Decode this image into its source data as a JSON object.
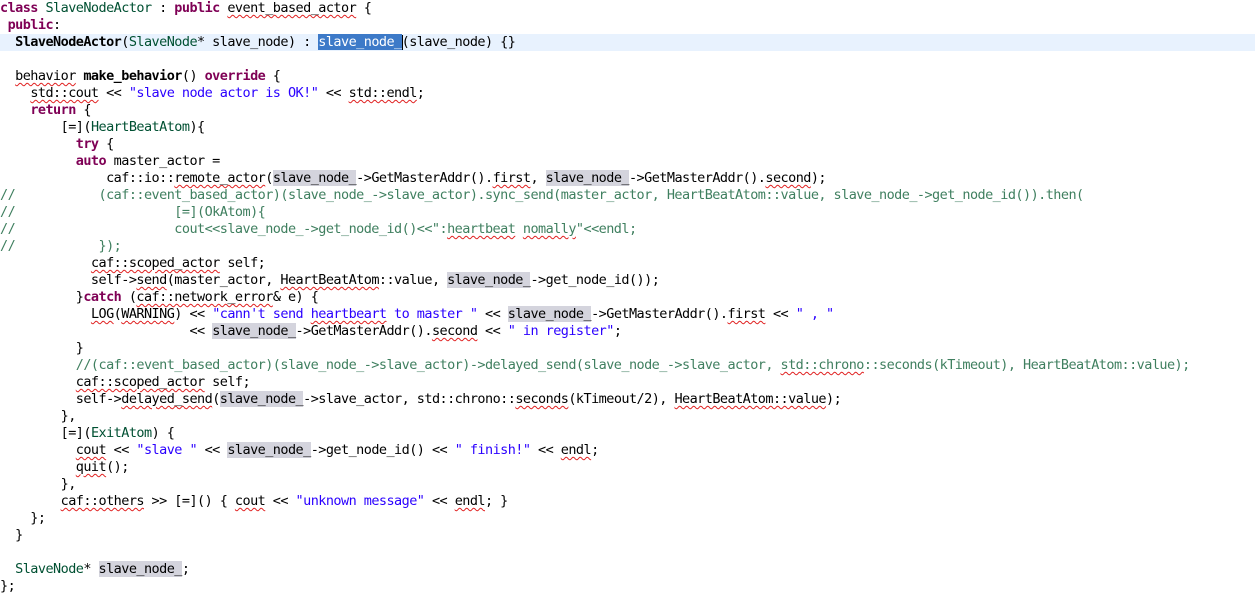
{
  "editor": {
    "lines": [
      [
        {
          "t": "class",
          "c": "kw"
        },
        {
          "t": " "
        },
        {
          "t": "SlaveNodeActor",
          "c": "type"
        },
        {
          "t": " : "
        },
        {
          "t": "public",
          "c": "kw"
        },
        {
          "t": " "
        },
        {
          "t": "event_based_actor",
          "c": "err"
        },
        {
          "t": " {"
        }
      ],
      [
        {
          "t": " "
        },
        {
          "t": "public",
          "c": "kw"
        },
        {
          "t": ":"
        }
      ],
      [
        {
          "t": "  "
        },
        {
          "t": "SlaveNodeActor",
          "c": "fn"
        },
        {
          "t": "("
        },
        {
          "t": "SlaveNode",
          "c": "type"
        },
        {
          "t": "* slave_node) : "
        },
        {
          "t": "slave_node_",
          "c": "sel",
          "caret": true
        },
        {
          "t": "(slave_node) {}"
        }
      ],
      [],
      [
        {
          "t": "  "
        },
        {
          "t": "behavior",
          "c": "err"
        },
        {
          "t": " "
        },
        {
          "t": "make_behavior",
          "c": "fn"
        },
        {
          "t": "() "
        },
        {
          "t": "override",
          "c": "kw"
        },
        {
          "t": " {"
        }
      ],
      [
        {
          "t": "    "
        },
        {
          "t": "std::cout",
          "c": "err"
        },
        {
          "t": " << "
        },
        {
          "t": "\"slave node actor is OK!\"",
          "c": "str"
        },
        {
          "t": " << "
        },
        {
          "t": "std::endl",
          "c": "err"
        },
        {
          "t": ";"
        }
      ],
      [
        {
          "t": "    "
        },
        {
          "t": "return",
          "c": "kw"
        },
        {
          "t": " {"
        }
      ],
      [
        {
          "t": "        [=]("
        },
        {
          "t": "HeartBeatAtom",
          "c": "type"
        },
        {
          "t": "){"
        }
      ],
      [
        {
          "t": "          "
        },
        {
          "t": "try",
          "c": "kw"
        },
        {
          "t": " {"
        }
      ],
      [
        {
          "t": "          "
        },
        {
          "t": "auto",
          "c": "kw"
        },
        {
          "t": " master_actor ="
        }
      ],
      [
        {
          "t": "              caf::io::"
        },
        {
          "t": "remote_actor",
          "c": "err"
        },
        {
          "t": "("
        },
        {
          "t": "slave_node_",
          "c": "occ"
        },
        {
          "t": "->GetMasterAddr()."
        },
        {
          "t": "first",
          "c": "err"
        },
        {
          "t": ", "
        },
        {
          "t": "slave_node_",
          "c": "occ"
        },
        {
          "t": "->GetMasterAddr()."
        },
        {
          "t": "second",
          "c": "err"
        },
        {
          "t": ");"
        }
      ],
      [
        {
          "t": "//           (caf::event_based_actor)(slave_node_->slave_actor).sync_send(master_actor, HeartBeatAtom::value, slave_node_->get_node_id()).then(",
          "c": "com"
        }
      ],
      [
        {
          "t": "//                     [=](OkAtom){",
          "c": "com"
        }
      ],
      [
        {
          "t": "//                     cout<<slave_node_->get_node_id()<<\":",
          "c": "com"
        },
        {
          "t": "heartbeat",
          "c": "com err"
        },
        {
          "t": " ",
          "c": "com"
        },
        {
          "t": "nomally",
          "c": "com err"
        },
        {
          "t": "\"<<endl;",
          "c": "com"
        }
      ],
      [
        {
          "t": "//           });",
          "c": "com"
        }
      ],
      [
        {
          "t": "            "
        },
        {
          "t": "caf::scoped_actor",
          "c": "err"
        },
        {
          "t": " self;"
        }
      ],
      [
        {
          "t": "            self->"
        },
        {
          "t": "send",
          "c": "err"
        },
        {
          "t": "(master_actor, "
        },
        {
          "t": "HeartBeatAtom",
          "c": "err"
        },
        {
          "t": "::value, "
        },
        {
          "t": "slave_node_",
          "c": "occ"
        },
        {
          "t": "->get_node_id());"
        }
      ],
      [
        {
          "t": "          }"
        },
        {
          "t": "catch",
          "c": "kw"
        },
        {
          "t": " ("
        },
        {
          "t": "caf::network_error",
          "c": "err"
        },
        {
          "t": "& e) {"
        }
      ],
      [
        {
          "t": "            "
        },
        {
          "t": "LOG",
          "c": "err"
        },
        {
          "t": "("
        },
        {
          "t": "WARNING",
          "c": "err"
        },
        {
          "t": ") << "
        },
        {
          "t": "\"cann't send ",
          "c": "str"
        },
        {
          "t": "heartbeart",
          "c": "str err"
        },
        {
          "t": " to master \"",
          "c": "str"
        },
        {
          "t": " << "
        },
        {
          "t": "slave_node_",
          "c": "occ"
        },
        {
          "t": "->GetMasterAddr()."
        },
        {
          "t": "first",
          "c": "err"
        },
        {
          "t": " << "
        },
        {
          "t": "\" , \"",
          "c": "str"
        }
      ],
      [
        {
          "t": "                         << "
        },
        {
          "t": "slave_node_",
          "c": "occ"
        },
        {
          "t": "->GetMasterAddr()."
        },
        {
          "t": "second",
          "c": "err"
        },
        {
          "t": " << "
        },
        {
          "t": "\" in register\"",
          "c": "str"
        },
        {
          "t": ";"
        }
      ],
      [
        {
          "t": "          }"
        }
      ],
      [
        {
          "t": "          //(caf::event_based_actor)(slave_node_->slave_actor)->delayed_send(slave_node_->slave_actor, ",
          "c": "com"
        },
        {
          "t": "std::chrono",
          "c": "com err"
        },
        {
          "t": "::seconds(kTimeout), HeartBeatAtom::value);",
          "c": "com"
        }
      ],
      [
        {
          "t": "          "
        },
        {
          "t": "caf::scoped_actor",
          "c": "err"
        },
        {
          "t": " self;"
        }
      ],
      [
        {
          "t": "          self->"
        },
        {
          "t": "delayed_send",
          "c": "err"
        },
        {
          "t": "("
        },
        {
          "t": "slave_node_",
          "c": "occ"
        },
        {
          "t": "->slave_actor, std::chrono::"
        },
        {
          "t": "seconds",
          "c": "err"
        },
        {
          "t": "(kTimeout/2), "
        },
        {
          "t": "HeartBeatAtom::value",
          "c": "err"
        },
        {
          "t": ");"
        }
      ],
      [
        {
          "t": "        },"
        }
      ],
      [
        {
          "t": "        [=]("
        },
        {
          "t": "ExitAtom",
          "c": "type"
        },
        {
          "t": ") {"
        }
      ],
      [
        {
          "t": "          "
        },
        {
          "t": "cout",
          "c": "err"
        },
        {
          "t": " << "
        },
        {
          "t": "\"slave \"",
          "c": "str"
        },
        {
          "t": " << "
        },
        {
          "t": "slave_node_",
          "c": "occ"
        },
        {
          "t": "->get_node_id() << "
        },
        {
          "t": "\" finish!\"",
          "c": "str"
        },
        {
          "t": " << "
        },
        {
          "t": "endl",
          "c": "err"
        },
        {
          "t": ";"
        }
      ],
      [
        {
          "t": "          "
        },
        {
          "t": "quit",
          "c": "err"
        },
        {
          "t": "();"
        }
      ],
      [
        {
          "t": "        },"
        }
      ],
      [
        {
          "t": "        "
        },
        {
          "t": "caf::others",
          "c": "err"
        },
        {
          "t": " >> [=]() { "
        },
        {
          "t": "cout",
          "c": "err"
        },
        {
          "t": " << "
        },
        {
          "t": "\"unknown message\"",
          "c": "str"
        },
        {
          "t": " << "
        },
        {
          "t": "endl",
          "c": "err"
        },
        {
          "t": "; }"
        }
      ],
      [
        {
          "t": "    };"
        }
      ],
      [
        {
          "t": "  }"
        }
      ],
      [],
      [
        {
          "t": "  "
        },
        {
          "t": "SlaveNode",
          "c": "type"
        },
        {
          "t": "* "
        },
        {
          "t": "slave_node_",
          "c": "occ"
        },
        {
          "t": ";"
        }
      ],
      [
        {
          "t": "};"
        }
      ]
    ]
  }
}
